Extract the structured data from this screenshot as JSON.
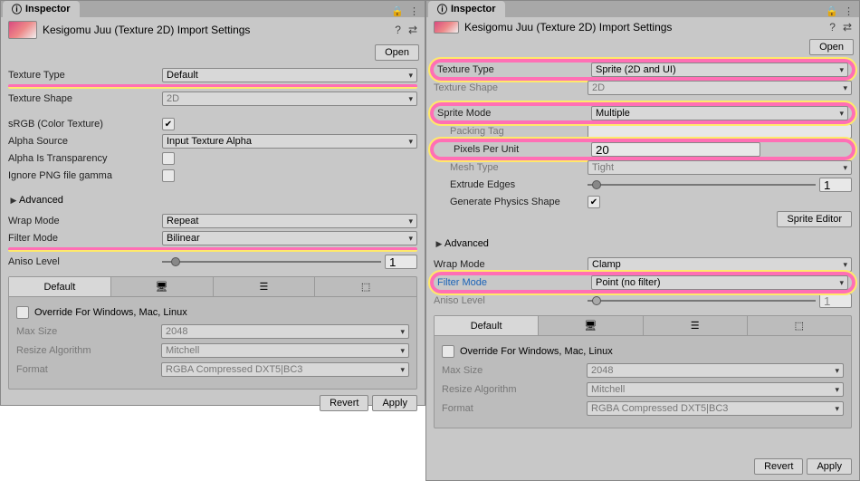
{
  "left": {
    "inspector_tab": "Inspector",
    "title": "Kesigomu Juu (Texture 2D) Import Settings",
    "open_btn": "Open",
    "rows": {
      "texture_type_label": "Texture Type",
      "texture_type_value": "Default",
      "texture_shape_label": "Texture Shape",
      "texture_shape_value": "2D",
      "srgb_label": "sRGB (Color Texture)",
      "srgb_checked": "✔",
      "alpha_source_label": "Alpha Source",
      "alpha_source_value": "Input Texture Alpha",
      "alpha_is_transparency_label": "Alpha Is Transparency",
      "ignore_png_gamma_label": "Ignore PNG file gamma",
      "advanced_label": "Advanced",
      "wrap_mode_label": "Wrap Mode",
      "wrap_mode_value": "Repeat",
      "filter_mode_label": "Filter Mode",
      "filter_mode_value": "Bilinear",
      "aniso_label": "Aniso Level",
      "aniso_value": "1"
    },
    "plat": {
      "default_tab": "Default",
      "override_label": "Override For Windows, Mac, Linux",
      "maxsize_label": "Max Size",
      "maxsize_value": "2048",
      "resize_label": "Resize Algorithm",
      "resize_value": "Mitchell",
      "format_label": "Format",
      "format_value": "RGBA Compressed DXT5|BC3"
    },
    "revert": "Revert",
    "apply": "Apply"
  },
  "right": {
    "inspector_tab": "Inspector",
    "title": "Kesigomu Juu (Texture 2D) Import Settings",
    "open_btn": "Open",
    "rows": {
      "texture_type_label": "Texture Type",
      "texture_type_value": "Sprite (2D and UI)",
      "texture_shape_label": "Texture Shape",
      "texture_shape_value": "2D",
      "sprite_mode_label": "Sprite Mode",
      "sprite_mode_value": "Multiple",
      "packing_tag_label": "Packing Tag",
      "ppu_label": "Pixels Per Unit",
      "ppu_value": "20",
      "mesh_type_label": "Mesh Type",
      "mesh_type_value": "Tight",
      "extrude_label": "Extrude Edges",
      "extrude_value": "1",
      "gen_physics_label": "Generate Physics Shape",
      "gen_physics_checked": "✔",
      "sprite_editor_btn": "Sprite Editor",
      "advanced_label": "Advanced",
      "wrap_mode_label": "Wrap Mode",
      "wrap_mode_value": "Clamp",
      "filter_mode_label": "Filter Mode",
      "filter_mode_value": "Point (no filter)",
      "aniso_label": "Aniso Level",
      "aniso_value": "1"
    },
    "plat": {
      "default_tab": "Default",
      "override_label": "Override For Windows, Mac, Linux",
      "maxsize_label": "Max Size",
      "maxsize_value": "2048",
      "resize_label": "Resize Algorithm",
      "resize_value": "Mitchell",
      "format_label": "Format",
      "format_value": "RGBA Compressed DXT5|BC3"
    },
    "revert": "Revert",
    "apply": "Apply"
  }
}
